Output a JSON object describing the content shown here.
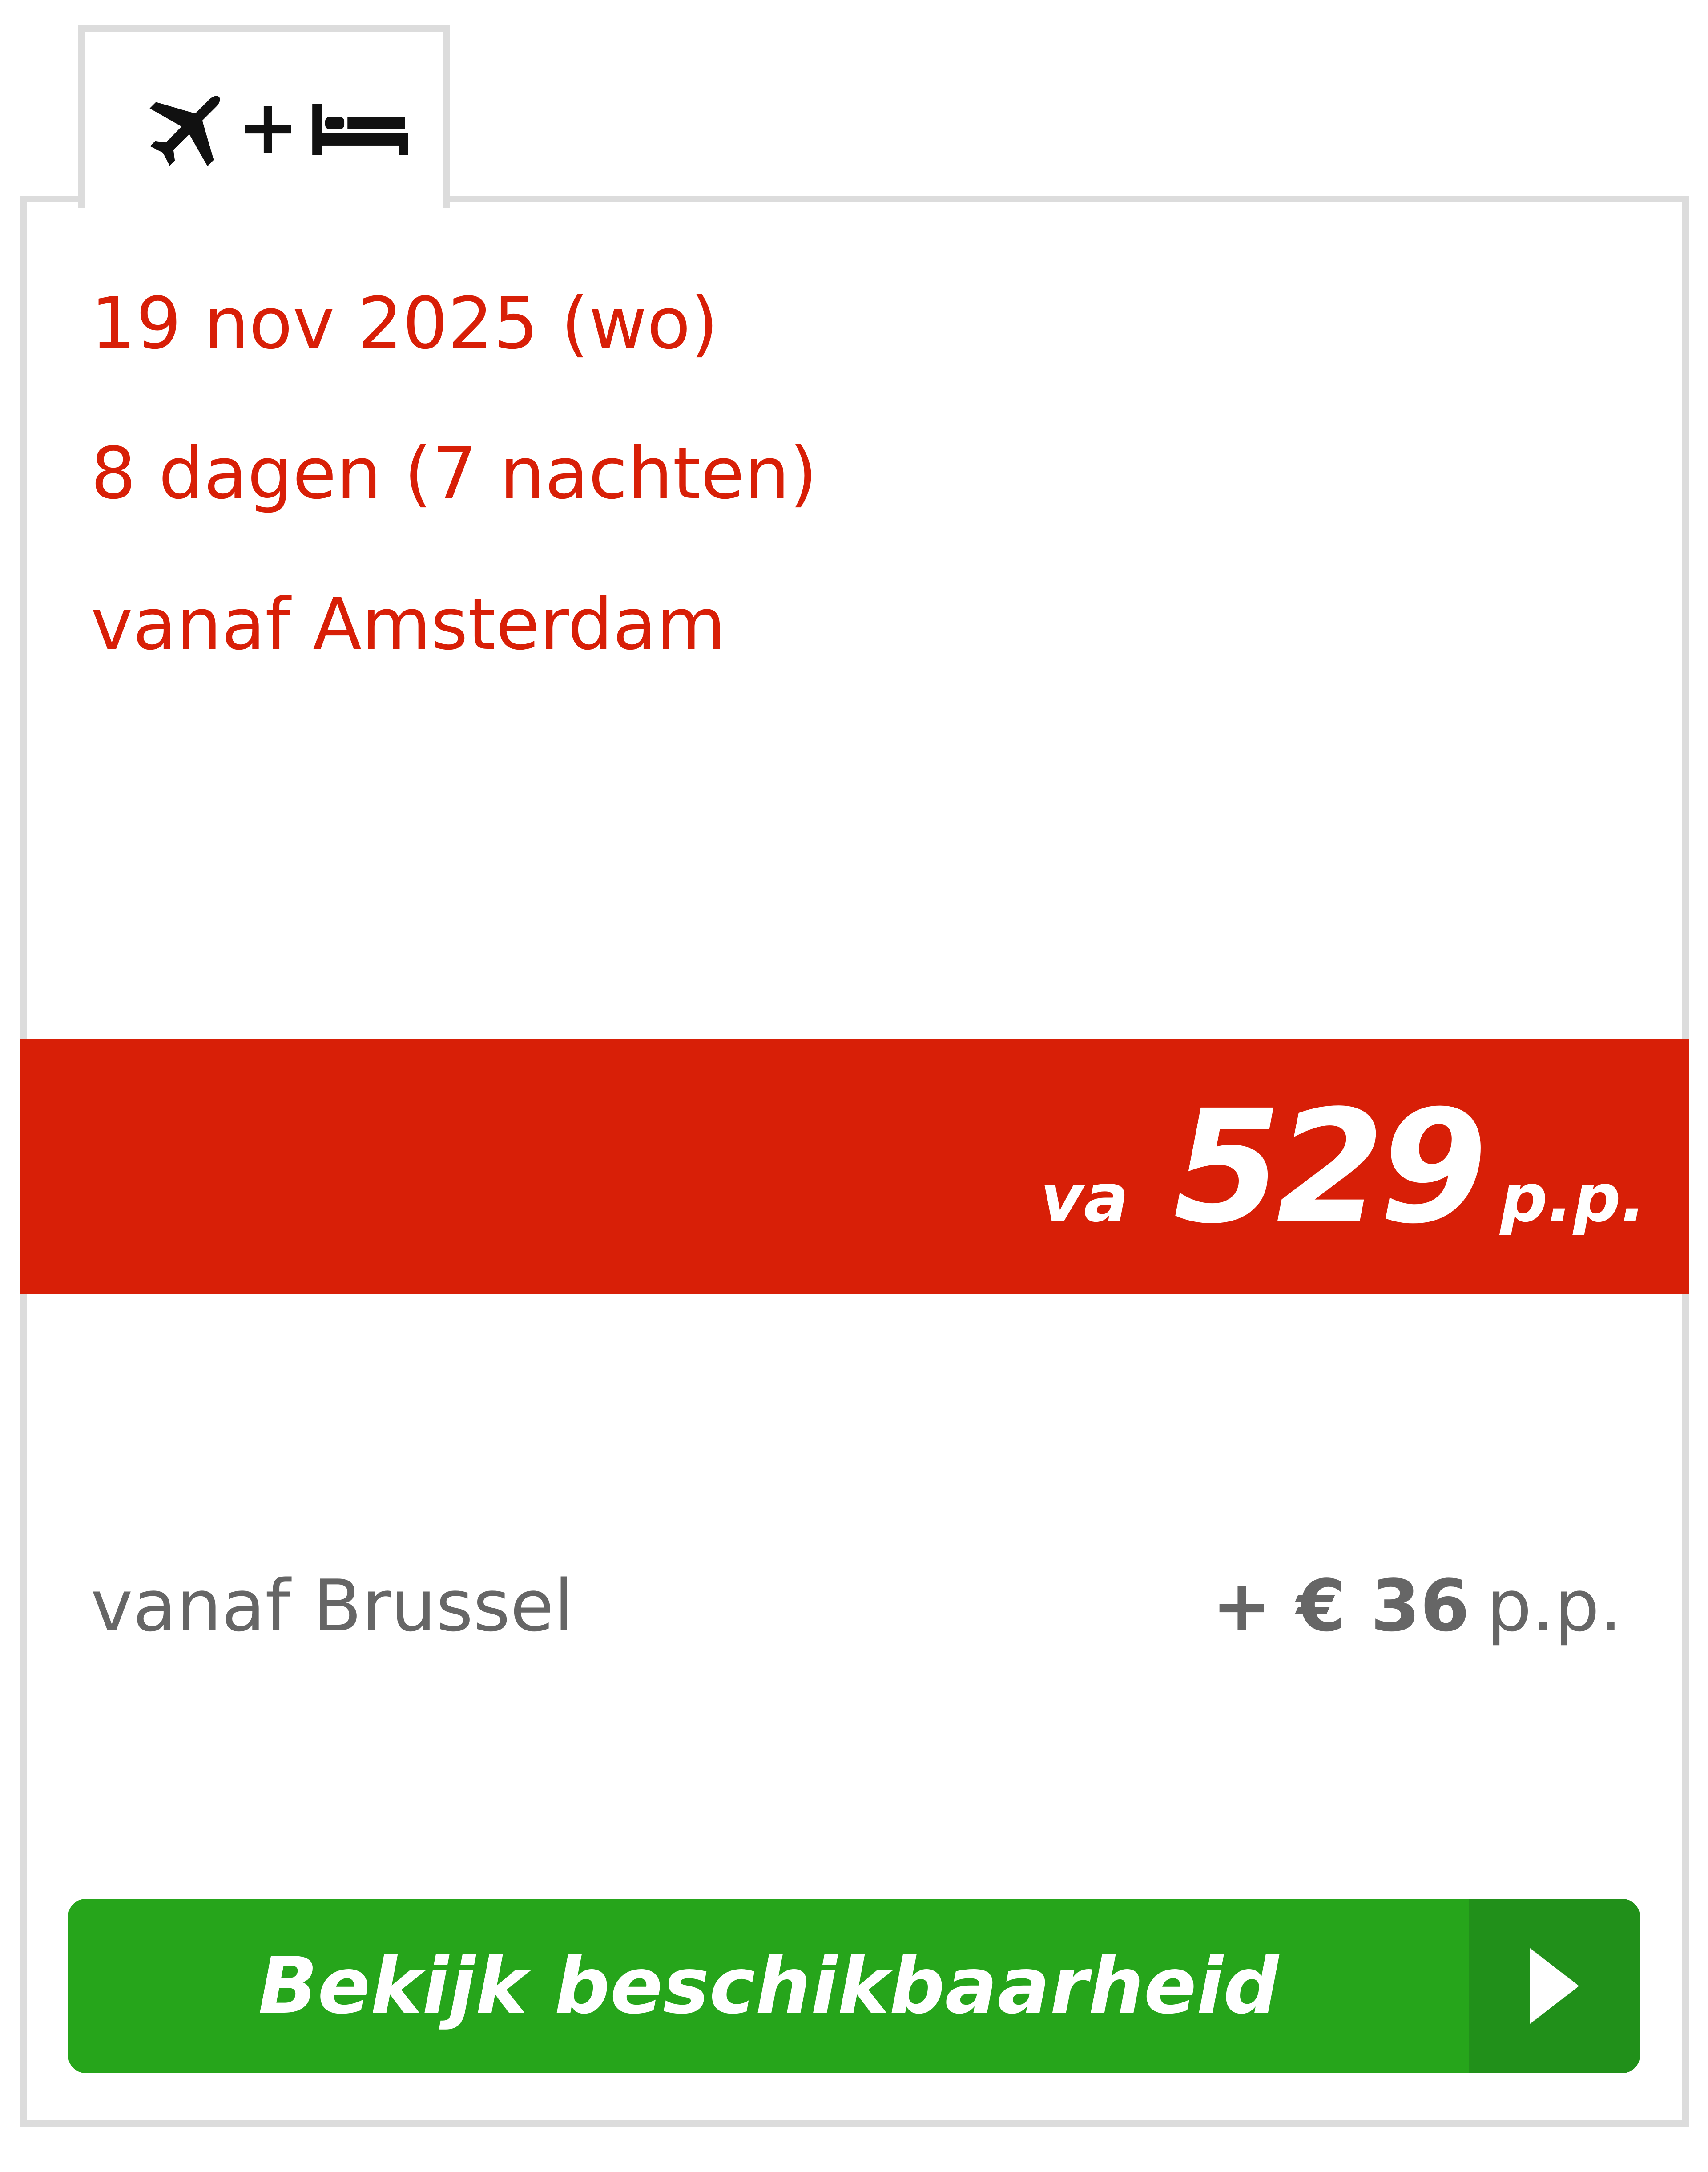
{
  "tab": {
    "icons": [
      "plane-icon",
      "plus-icon",
      "bed-icon"
    ]
  },
  "trip": {
    "date": "19 nov 2025 (wo)",
    "duration": "8 dagen (7 nachten)",
    "departure": "vanaf Amsterdam"
  },
  "price": {
    "prefix": "va",
    "amount": "529",
    "suffix": "p.p."
  },
  "surcharge": {
    "label": "vanaf Brussel",
    "amount": "+ € 36",
    "suffix": "p.p."
  },
  "cta": {
    "label": "Bekijk beschikbaarheid",
    "arrow_icon": "chevron-right-icon"
  },
  "colors": {
    "accent_red": "#d81f07",
    "button_green": "#26a51b",
    "button_green_dark": "#21901a",
    "border_gray": "#dcdcdc",
    "muted_text": "#666666"
  }
}
